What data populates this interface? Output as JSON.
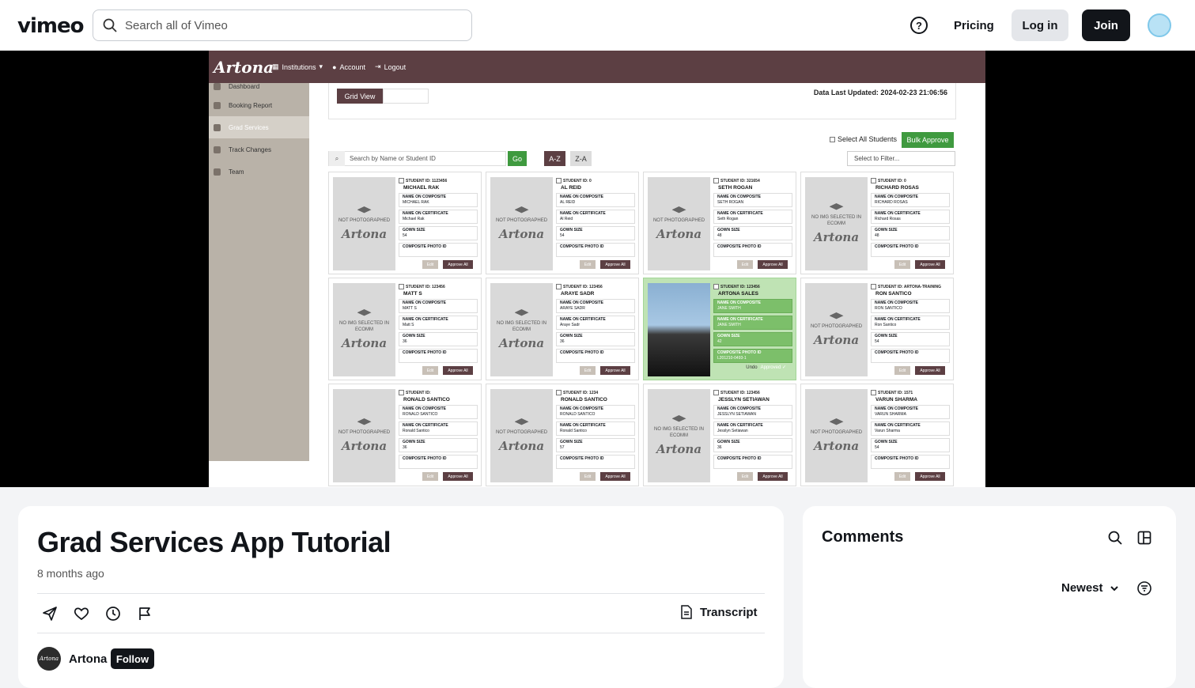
{
  "header": {
    "logo": "vimeo",
    "search_placeholder": "Search all of Vimeo",
    "pricing": "Pricing",
    "login": "Log in",
    "join": "Join"
  },
  "video_app": {
    "logo": "Artona",
    "nav": [
      "Institutions",
      "Account",
      "Logout"
    ],
    "sidebar": [
      "Dashboard",
      "Booking Report",
      "Grad Services",
      "Track Changes",
      "Team"
    ],
    "grid_view": "Grid View",
    "data_updated": "Data Last Updated: 2024-02-23 21:06:56",
    "select_all": "Select All Students",
    "bulk_approve": "Bulk Approve",
    "search_placeholder": "Search by Name or Student ID",
    "go": "Go",
    "az": "A-Z",
    "za": "Z-A",
    "filter": "Select to Filter...",
    "lbl_composite": "NAME ON COMPOSITE",
    "lbl_certificate": "NAME ON CERTIFICATE",
    "lbl_gown": "GOWN SIZE",
    "lbl_photo": "COMPOSITE PHOTO ID",
    "edit": "Edit",
    "approve_all": "Approve All",
    "undo": "Undo",
    "approved": "Approved ✓",
    "students": [
      {
        "id": "STUDENT ID: 1123456",
        "name": "MICHAEL RAK",
        "composite": "MICHAEL RAK",
        "certificate": "Michael Rak",
        "gown": "54",
        "photo_id": "",
        "status": "NOT PHOTOGRAPHED"
      },
      {
        "id": "STUDENT ID: 0",
        "name": "AL REID",
        "composite": "AL REID",
        "certificate": "Al Reid",
        "gown": "54",
        "photo_id": "",
        "status": "NOT PHOTOGRAPHED"
      },
      {
        "id": "STUDENT ID: 321654",
        "name": "SETH ROGAN",
        "composite": "SETH ROGAN",
        "certificate": "Seth Rogan",
        "gown": "48",
        "photo_id": "",
        "status": "NOT PHOTOGRAPHED"
      },
      {
        "id": "STUDENT ID: 0",
        "name": "RICHARD ROSAS",
        "composite": "RICHARD ROSAS",
        "certificate": "Richard Rosas",
        "gown": "48",
        "photo_id": "",
        "status": "NO IMG SELECTED IN ECOMM"
      },
      {
        "id": "STUDENT ID: 123456",
        "name": "MATT S",
        "composite": "MATT S",
        "certificate": "Matt S",
        "gown": "36",
        "photo_id": "",
        "status": "NO IMG SELECTED IN ECOMM"
      },
      {
        "id": "STUDENT ID: 123456",
        "name": "ARAYE SADR",
        "composite": "ARAYE SADR",
        "certificate": "Araye Sadr",
        "gown": "36",
        "photo_id": "",
        "status": "NO IMG SELECTED IN ECOMM"
      },
      {
        "id": "STUDENT ID: 123456",
        "name": "ARTONA SALES",
        "composite": "JANE SMITH",
        "certificate": "JANE SMITH",
        "gown": "42",
        "photo_id": "L201210-0493-1",
        "status": "PHOTO"
      },
      {
        "id": "STUDENT ID: ARTONA-TRAINING",
        "name": "RON SANTICO",
        "composite": "RON SANTICO",
        "certificate": "Ron Santico",
        "gown": "54",
        "photo_id": "",
        "status": "NOT PHOTOGRAPHED"
      },
      {
        "id": "STUDENT ID:",
        "name": "RONALD SANTICO",
        "composite": "RONALD SANTICO",
        "certificate": "Ronald Santico",
        "gown": "36",
        "photo_id": "",
        "status": "NOT PHOTOGRAPHED"
      },
      {
        "id": "STUDENT ID: 1234",
        "name": "RONALD SANTICO",
        "composite": "RONALD SANTICO",
        "certificate": "Ronald Santico",
        "gown": "57",
        "photo_id": "",
        "status": "NOT PHOTOGRAPHED"
      },
      {
        "id": "STUDENT ID: 123456",
        "name": "JESSLYN SETIAWAN",
        "composite": "JESSLYN SETIAWAN",
        "certificate": "Jesslyn Setiawan",
        "gown": "36",
        "photo_id": "",
        "status": "NO IMG SELECTED IN ECOMM"
      },
      {
        "id": "STUDENT ID: 1571",
        "name": "VARUN SHARMA",
        "composite": "VARUN SHARMA",
        "certificate": "Varun Sharma",
        "gown": "54",
        "photo_id": "",
        "status": "NOT PHOTOGRAPHED"
      }
    ]
  },
  "video": {
    "title": "Grad Services App Tutorial",
    "age": "8 months ago",
    "transcript": "Transcript",
    "channel": "Artona",
    "follow": "Follow"
  },
  "comments": {
    "title": "Comments",
    "sort": "Newest"
  }
}
